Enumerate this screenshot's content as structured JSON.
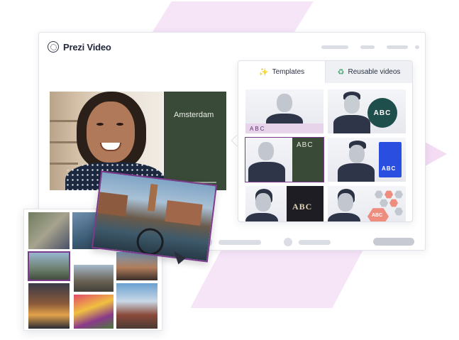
{
  "app": {
    "brand_name": "Prezi Video"
  },
  "video": {
    "overlay_title": "Amsterdam"
  },
  "panel": {
    "tabs": [
      {
        "label": "Templates",
        "icon": "magic-wand-icon",
        "active": true
      },
      {
        "label": "Reusable videos",
        "icon": "recycle-icon",
        "active": false
      }
    ],
    "templates": [
      {
        "label": "ABC",
        "style": "lower-third-pink"
      },
      {
        "label": "ABC",
        "style": "teal-circle"
      },
      {
        "label": "ABC",
        "style": "green-board",
        "selected": true
      },
      {
        "label": "ABC",
        "style": "blue-book"
      },
      {
        "label": "ABC",
        "style": "dark-board"
      },
      {
        "label": "ABC",
        "style": "hexagons"
      }
    ]
  },
  "colors": {
    "accent_purple": "#7c3a8c",
    "green_panel": "#3a4a38",
    "teal": "#1e4f4c",
    "blue": "#2a4fe0",
    "salmon": "#ee8c7e",
    "pink_decor": "#f6e4f7"
  }
}
